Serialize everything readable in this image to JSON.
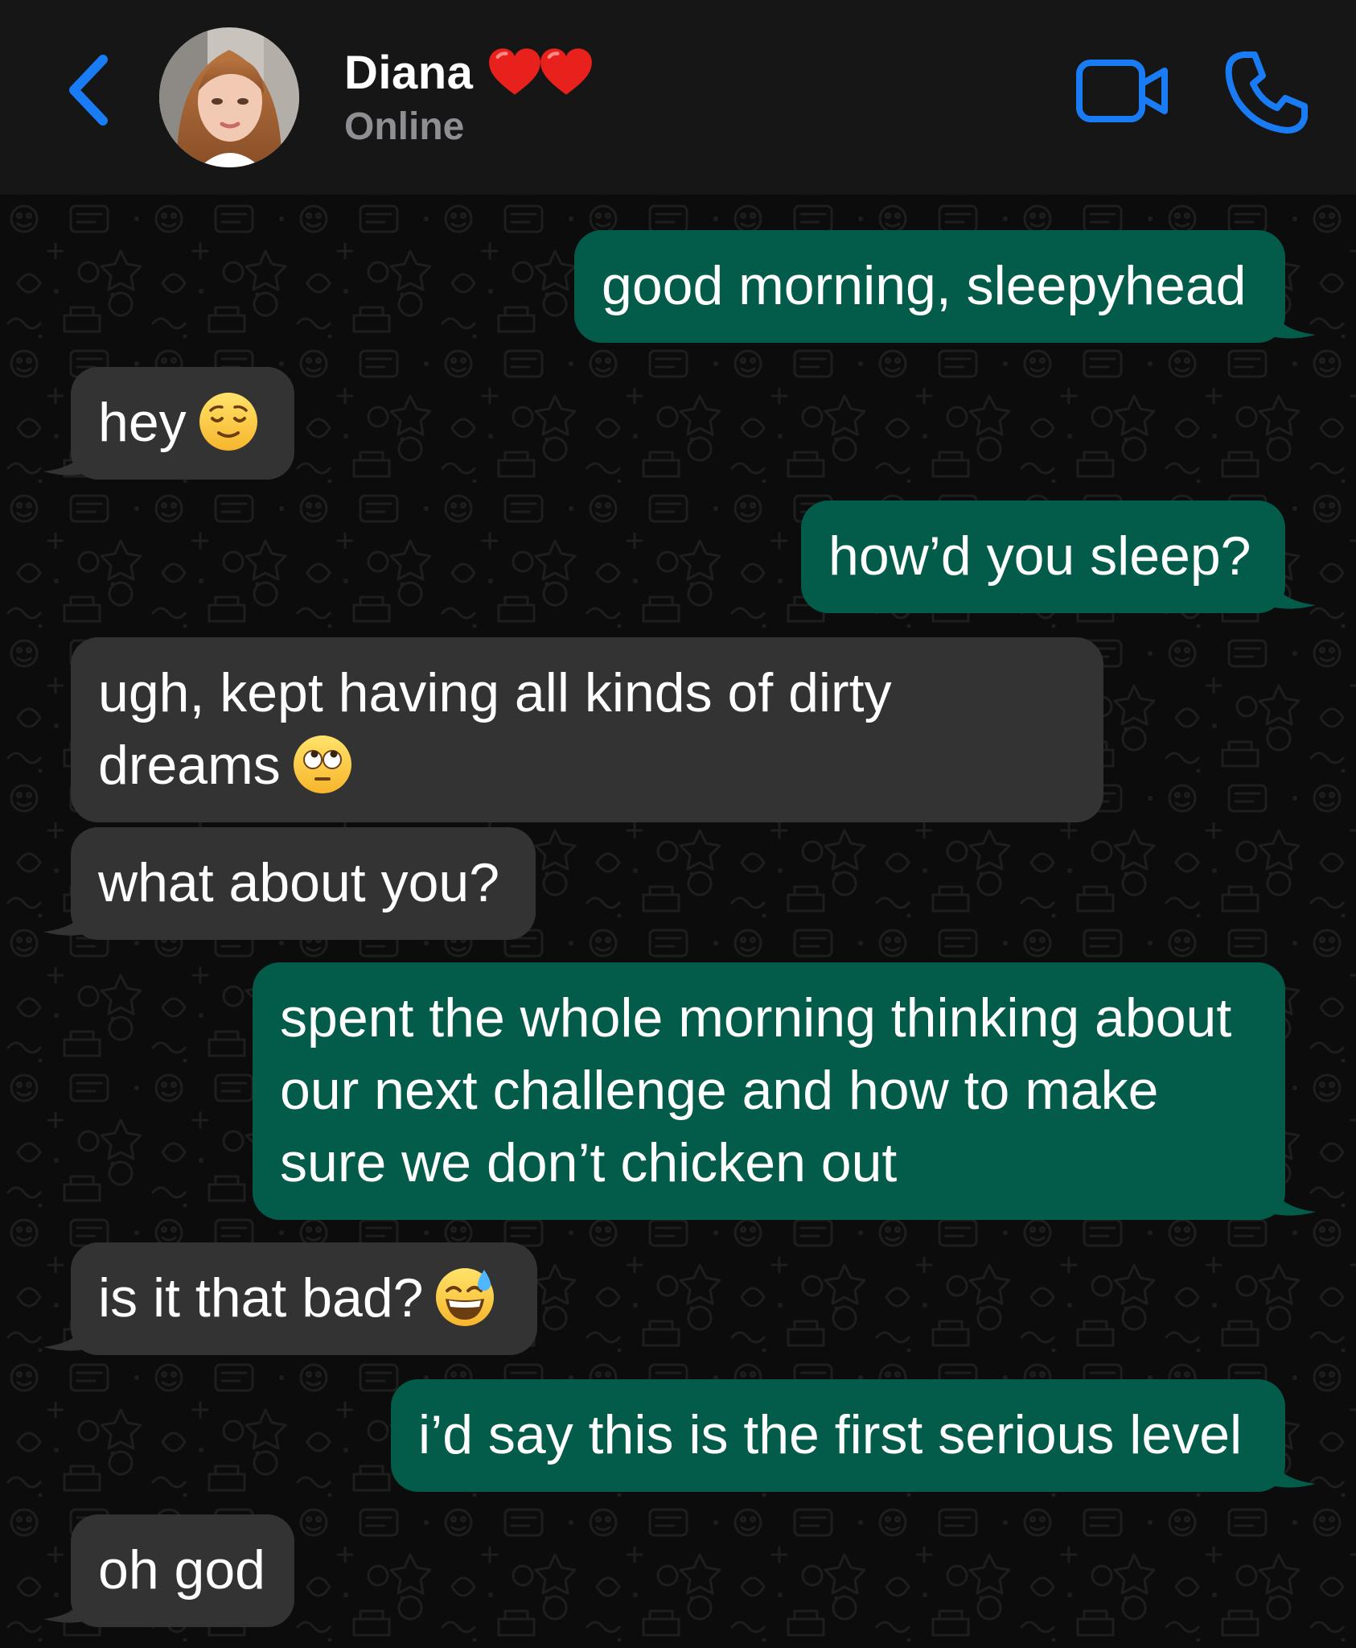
{
  "header": {
    "contact_name": "Diana",
    "contact_status": "Online",
    "name_decoration": [
      "red-heart",
      "red-heart"
    ],
    "icons": {
      "back": "chevron-left-icon",
      "video_call": "video-camera-icon",
      "voice_call": "phone-icon"
    }
  },
  "colors": {
    "header_bg": "#161616",
    "chat_bg": "#0c0c0c",
    "outgoing_bubble": "#035c49",
    "incoming_bubble": "#333333",
    "accent_blue": "#1a7cf5",
    "status_gray": "#8e8e93",
    "text": "#ffffff"
  },
  "messages": [
    {
      "direction": "outgoing",
      "text": "good morning, sleepyhead"
    },
    {
      "direction": "incoming",
      "text": "hey",
      "emoji": "relieved-face"
    },
    {
      "direction": "outgoing",
      "text": "how’d you sleep?"
    },
    {
      "direction": "incoming",
      "text": "ugh, kept having all kinds of dirty dreams",
      "emoji": "face-with-rolling-eyes"
    },
    {
      "direction": "incoming",
      "text": "what about you?"
    },
    {
      "direction": "outgoing",
      "text": "spent the whole morning thinking about our next challenge and how to make sure we don’t chicken out"
    },
    {
      "direction": "incoming",
      "text": "is it that bad?",
      "emoji": "grinning-face-with-sweat"
    },
    {
      "direction": "outgoing",
      "text": "i’d say this is the first serious level"
    },
    {
      "direction": "incoming",
      "text": "oh god"
    }
  ]
}
